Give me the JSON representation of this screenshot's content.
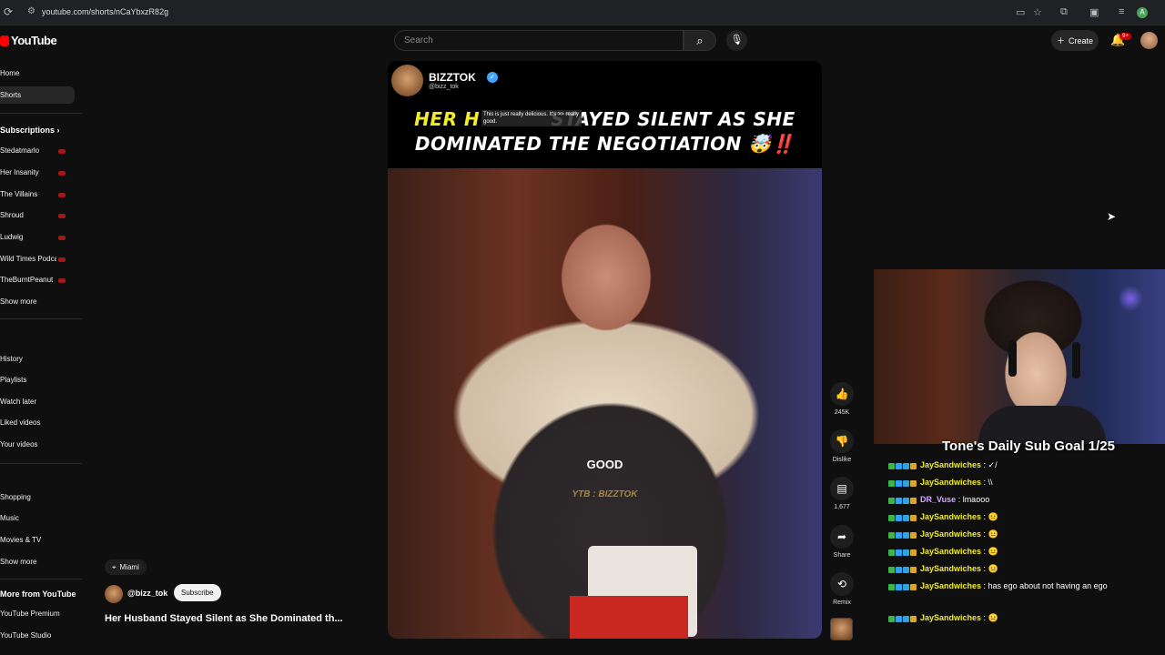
{
  "browser": {
    "url": "youtube.com/shorts/nCaYbxzR82g",
    "profile_letter": "A"
  },
  "header": {
    "logo_text": "YouTube",
    "search_placeholder": "Search",
    "create_label": "Create",
    "notification_count": "9+"
  },
  "sidebar": {
    "top_items": [
      "Home",
      "Shorts"
    ],
    "subscriptions_label": "Subscriptions",
    "subscriptions": [
      "Stedatmarlo",
      "Her Insanity",
      "The Villains",
      "Shroud",
      "Ludwig",
      "Wild Times Podcast",
      "TheBurntPeanut"
    ],
    "show_more_1": "Show more",
    "you_items": [
      "History",
      "Playlists",
      "Watch later",
      "Liked videos",
      "Your videos"
    ],
    "explore_items": [
      "Shopping",
      "Music",
      "Movies & TV"
    ],
    "show_more_2": "Show more",
    "more_from_label": "More from YouTube",
    "more_from_items": [
      "YouTube Premium",
      "YouTube Studio"
    ]
  },
  "video": {
    "channel_name": "BIZZTOK",
    "channel_handle": "@bizz_tok",
    "headline_line1_yellow": "HER H",
    "headline_line1_white": "STAYED SILENT AS SHE",
    "headline_line2": "DOMINATED THE NEGOTIATION 🤯‼️",
    "overlay_note": "This is just really delicious. It's >> really good.",
    "caption": "GOOD",
    "watermark": "YTB : BIZZTOK"
  },
  "actions": {
    "like_count": "245K",
    "dislike_label": "Dislike",
    "comment_count": "1,677",
    "share_label": "Share",
    "remix_label": "Remix"
  },
  "details": {
    "location": "Miami",
    "handle": "@bizz_tok",
    "subscribe_label": "Subscribe",
    "title": "Her Husband Stayed Silent as She Dominated th..."
  },
  "stream_overlay": {
    "sub_goal": "Tone's Daily Sub Goal 1/25",
    "chat": [
      {
        "user": "JaySandwiches",
        "message": ": ✓/",
        "color": "#f2ec2a"
      },
      {
        "user": "JaySandwiches",
        "message": ": \\\\",
        "color": "#f2ec2a"
      },
      {
        "user": "DR_Vuse",
        "message": ": lmaooo",
        "color": "#d6a6ff"
      },
      {
        "user": "JaySandwiches",
        "message": ": 😐",
        "color": "#f2ec2a"
      },
      {
        "user": "JaySandwiches",
        "message": ": 😐",
        "color": "#f2ec2a"
      },
      {
        "user": "JaySandwiches",
        "message": ": 😐",
        "color": "#f2ec2a"
      },
      {
        "user": "JaySandwiches",
        "message": ": 😐",
        "color": "#f2ec2a"
      },
      {
        "user": "JaySandwiches",
        "message": ": has ego about not having an ego",
        "color": "#f2ec2a"
      },
      {
        "user": "JaySandwiches",
        "message": ": 😐",
        "color": "#f2ec2a"
      }
    ]
  },
  "colors": {
    "background": "#0f0f0f",
    "youtube_red": "#ff0000",
    "verified_blue": "#3ea6ff",
    "headline_yellow": "#f2ec2a"
  }
}
